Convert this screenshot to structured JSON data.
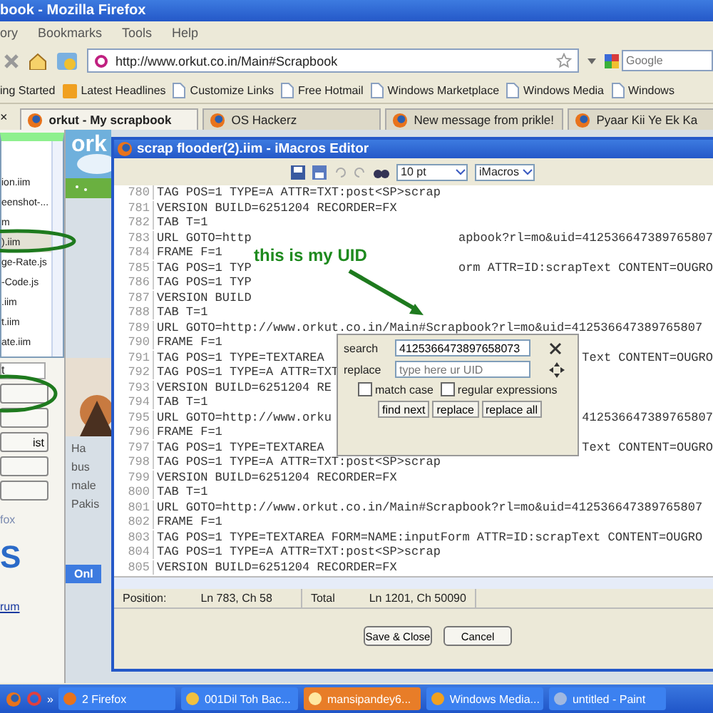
{
  "window": {
    "title": "book - Mozilla Firefox"
  },
  "menu": [
    "ory",
    "Bookmarks",
    "Tools",
    "Help"
  ],
  "nav": {
    "url": "http://www.orkut.co.in/Main#Scrapbook",
    "search_placeholder": "Google"
  },
  "bookmarks": [
    {
      "label": "ing Started",
      "kind": "plain"
    },
    {
      "label": "Latest Headlines",
      "kind": "feed"
    },
    {
      "label": "Customize Links",
      "kind": "page"
    },
    {
      "label": "Free Hotmail",
      "kind": "page"
    },
    {
      "label": "Windows Marketplace",
      "kind": "page"
    },
    {
      "label": "Windows Media",
      "kind": "page"
    },
    {
      "label": "Windows",
      "kind": "page"
    }
  ],
  "sidebar": {
    "close": "×",
    "files": [
      {
        "name": "ion.iim",
        "selected": false
      },
      {
        "name": "eenshot-...",
        "selected": false
      },
      {
        "name": "m",
        "selected": false
      },
      {
        "name": ").iim",
        "selected": true
      },
      {
        "name": "ge-Rate.js",
        "selected": false
      },
      {
        "name": "-Code.js",
        "selected": false
      },
      {
        "name": ".iim",
        "selected": false
      },
      {
        "name": "t.iim",
        "selected": false
      },
      {
        "name": "ate.iim",
        "selected": false
      }
    ],
    "tab": "t",
    "buttons": [
      {
        "kind": "blank"
      },
      {
        "kind": "blank"
      },
      {
        "kind": "text",
        "label": "ist"
      },
      {
        "kind": "blank"
      },
      {
        "kind": "blank"
      }
    ],
    "caption": "fox",
    "logo": "S",
    "link": "rum"
  },
  "tabs": [
    {
      "title": "orkut - My scrapbook",
      "selected": true
    },
    {
      "title": "OS Hackerz",
      "selected": false
    },
    {
      "title": "New message from prikle!",
      "selected": false
    },
    {
      "title": "Pyaar Kii Ye Ek Ka",
      "selected": false
    }
  ],
  "page": {
    "logo": "ork",
    "texts": [
      "Ha",
      "bus",
      "male",
      "Pakis"
    ],
    "online": "Onl"
  },
  "editor": {
    "title": "scrap flooder(2).iim - iMacros Editor",
    "font_size": "10 pt",
    "mode": "iMacros",
    "lines": [
      {
        "number": "780",
        "text": "TAG POS=1 TYPE=A ATTR=TXT:post<SP>scrap"
      },
      {
        "number": "781",
        "text": "VERSION BUILD=6251204 RECORDER=FX"
      },
      {
        "number": "782",
        "text": "TAB T=1"
      },
      {
        "number": "783",
        "text": "URL GOTO=http",
        "tail": "apbook?rl=mo&uid=412536647389765807"
      },
      {
        "number": "784",
        "text": "FRAME F=1"
      },
      {
        "number": "785",
        "text": "TAG POS=1 TYP",
        "tail": "orm ATTR=ID:scrapText CONTENT=OUGRO"
      },
      {
        "number": "786",
        "text": "TAG POS=1 TYP"
      },
      {
        "number": "787",
        "text": "VERSION BUILD"
      },
      {
        "number": "788",
        "text": "TAB T=1"
      },
      {
        "number": "789",
        "text": "URL GOTO=http://www.orkut.co.in/Main#Scrapbook?rl=mo&uid=412536647389765807"
      },
      {
        "number": "790",
        "text": "FRAME F=1"
      },
      {
        "number": "791",
        "text": "TAG POS=1 TYPE=TEXTAREA",
        "tail": "Text CONTENT=OUGRO"
      },
      {
        "number": "792",
        "text": "TAG POS=1 TYPE=A ATTR=TXT"
      },
      {
        "number": "793",
        "text": "VERSION BUILD=6251204 RE"
      },
      {
        "number": "794",
        "text": "TAB T=1"
      },
      {
        "number": "795",
        "text": "URL GOTO=http://www.orku",
        "tail": "412536647389765807"
      },
      {
        "number": "796",
        "text": "FRAME F=1"
      },
      {
        "number": "797",
        "text": "TAG POS=1 TYPE=TEXTAREA",
        "tail": "Text CONTENT=OUGRO"
      },
      {
        "number": "798",
        "text": "TAG POS=1 TYPE=A ATTR=TXT:post<SP>scrap"
      },
      {
        "number": "799",
        "text": "VERSION BUILD=6251204 RECORDER=FX"
      },
      {
        "number": "800",
        "text": "TAB T=1"
      },
      {
        "number": "801",
        "text": "URL GOTO=http://www.orkut.co.in/Main#Scrapbook?rl=mo&uid=412536647389765807"
      },
      {
        "number": "802",
        "text": "FRAME F=1"
      },
      {
        "number": "803",
        "text": "TAG POS=1 TYPE=TEXTAREA FORM=NAME:inputForm ATTR=ID:scrapText CONTENT=OUGRO"
      },
      {
        "number": "804",
        "text": "TAG POS=1 TYPE=A ATTR=TXT:post<SP>scrap"
      },
      {
        "number": "805",
        "text": "VERSION BUILD=6251204 RECORDER=FX"
      }
    ],
    "status": {
      "position_label": "Position:",
      "position": "Ln 783, Ch 58",
      "total_label": "Total",
      "total": "Ln 1201, Ch 50090"
    },
    "buttons": [
      "Save & Close",
      "Cancel"
    ]
  },
  "find_dialog": {
    "search_label": "search",
    "search_value": "4125366473897658073",
    "replace_label": "replace",
    "replace_placeholder": "type here ur UID",
    "options": [
      {
        "label": "match case",
        "checked": false
      },
      {
        "label": "regular expressions",
        "checked": false
      }
    ],
    "buttons": [
      "find next",
      "replace",
      "replace all"
    ]
  },
  "annotation": {
    "label": "this is my UID"
  },
  "taskbar": {
    "more": "»",
    "items": [
      {
        "label": "2 Firefox",
        "kind": "group",
        "selected": false
      },
      {
        "label": "001Dil Toh Bac...",
        "kind": "folder",
        "selected": false
      },
      {
        "label": "mansipandey6...",
        "kind": "chat",
        "selected": true
      },
      {
        "label": "Windows Media...",
        "kind": "media",
        "selected": false
      },
      {
        "label": "untitled - Paint",
        "kind": "paint",
        "selected": false
      }
    ]
  }
}
